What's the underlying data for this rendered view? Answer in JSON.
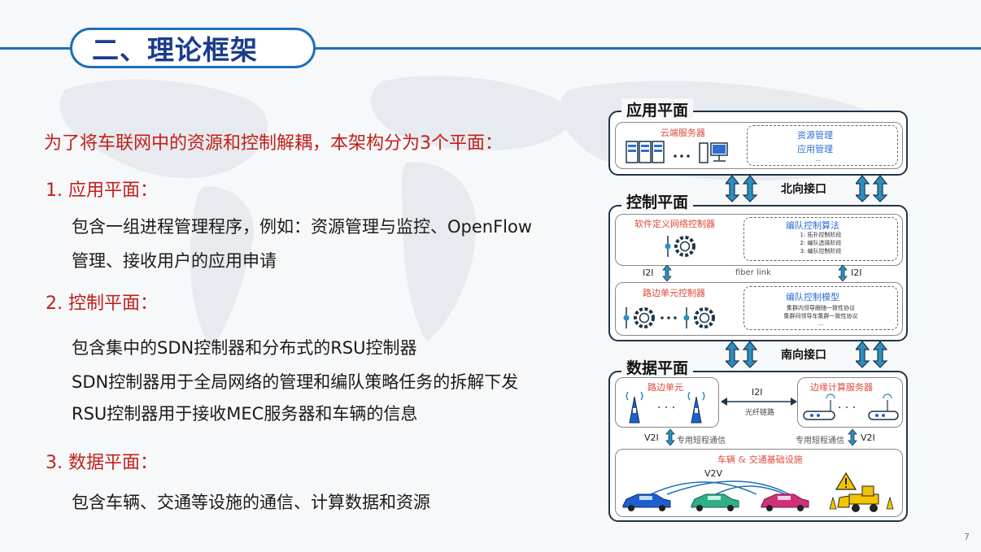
{
  "header": {
    "title": "二、理论框架"
  },
  "content": {
    "intro": "为了将车联网中的资源和控制解耦，本架构分为3个平面：",
    "sections": [
      {
        "title": "1. 应用平面：",
        "lines": [
          "包含一组进程管理程序，例如：资源管理与监控、OpenFlow",
          "管理、接收用户的应用申请"
        ]
      },
      {
        "title": "2. 控制平面：",
        "lines": [
          "包含集中的SDN控制器和分布式的RSU控制器",
          "SDN控制器用于全局网络的管理和编队策略任务的拆解下发",
          "RSU控制器用于接收MEC服务器和车辆的信息"
        ]
      },
      {
        "title": "3. 数据平面：",
        "lines": [
          "包含车辆、交通等设施的通信、计算数据和资源"
        ]
      }
    ]
  },
  "diagram": {
    "app_plane": {
      "label": "应用平面",
      "cloud": "云端服务器",
      "mgmt": [
        "资源管理",
        "应用管理",
        "..."
      ]
    },
    "north_interface": "北向接口",
    "control_plane": {
      "label": "控制平面",
      "sdn": "软件定义网络控制器",
      "algo_title": "编队控制算法",
      "algo_items": [
        "1: 拓扑控制阶段",
        "2: 编队选择阶段",
        "3: 编队控制阶段"
      ],
      "i2i_left": "I2I",
      "i2i_right": "I2I",
      "fiber": "fiber link",
      "rsu": "路边单元控制器",
      "model_title": "编队控制模型",
      "model_items": [
        "集群内领导跟随一致性协议",
        "集群间领导车集群一致性协议",
        "..."
      ]
    },
    "south_interface": "南向接口",
    "data_plane": {
      "label": "数据平面",
      "rsu_unit": "路边单元",
      "edge": "边缘计算服务器",
      "i2i": "I2I",
      "fiber": "光纤链路",
      "v2i_left": "V2I",
      "v2i_right": "V2I",
      "dsrc_left": "专用短程通信",
      "dsrc_right": "专用短程通信",
      "vehicles": "车辆 & 交通基础设施",
      "v2v": "V2V",
      "ellipsis": "· · ·"
    }
  },
  "colors": {
    "accent": "#1e6fb8",
    "title": "#1a3c8c",
    "red": "#c0201a",
    "car_blue": "#1e5fd0",
    "car_green": "#2fae8a",
    "car_pink": "#d0307a"
  },
  "page_number": "7"
}
